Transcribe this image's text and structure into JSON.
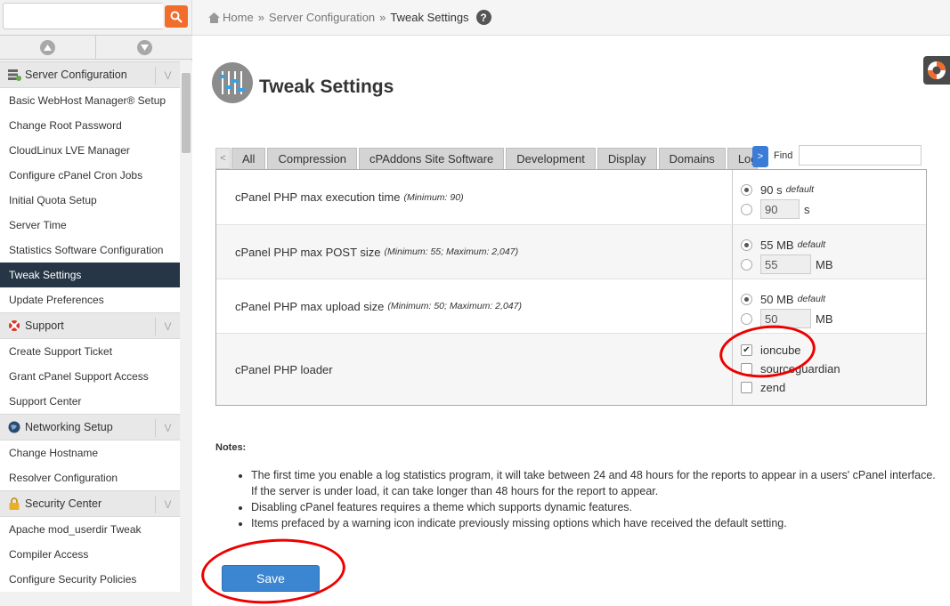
{
  "sidebar": {
    "search": {
      "value": "",
      "placeholder": ""
    },
    "groups": [
      {
        "title": "Server Configuration",
        "items": [
          "Basic WebHost Manager® Setup",
          "Change Root Password",
          "CloudLinux LVE Manager",
          "Configure cPanel Cron Jobs",
          "Initial Quota Setup",
          "Server Time",
          "Statistics Software Configuration",
          "Tweak Settings",
          "Update Preferences"
        ]
      },
      {
        "title": "Support",
        "items": [
          "Create Support Ticket",
          "Grant cPanel Support Access",
          "Support Center"
        ]
      },
      {
        "title": "Networking Setup",
        "items": [
          "Change Hostname",
          "Resolver Configuration"
        ]
      },
      {
        "title": "Security Center",
        "items": [
          "Apache mod_userdir Tweak",
          "Compiler Access",
          "Configure Security Policies"
        ]
      }
    ],
    "active_item": "Tweak Settings",
    "chevron": "V"
  },
  "breadcrumb": {
    "home": "Home",
    "sep": "»",
    "level1": "Server Configuration",
    "current": "Tweak Settings"
  },
  "help_icon": "?",
  "page": {
    "title": "Tweak Settings"
  },
  "tabs": {
    "prev": "<",
    "next": ">",
    "items": [
      "All",
      "Compression",
      "cPAddons Site Software",
      "Development",
      "Display",
      "Domains",
      "Logg"
    ]
  },
  "find": {
    "label": "Find",
    "value": ""
  },
  "settings": [
    {
      "label": "cPanel PHP max execution time",
      "hint": "(Minimum: 90)",
      "default_label": "90 s",
      "default_tag": "default",
      "custom_value": "90",
      "unit": "s"
    },
    {
      "label": "cPanel PHP max POST size",
      "hint": "(Minimum: 55; Maximum: 2,047)",
      "default_label": "55 MB",
      "default_tag": "default",
      "custom_value": "55",
      "unit": "MB"
    },
    {
      "label": "cPanel PHP max upload size",
      "hint": "(Minimum: 50; Maximum: 2,047)",
      "default_label": "50 MB",
      "default_tag": "default",
      "custom_value": "50",
      "unit": "MB"
    }
  ],
  "loader": {
    "label": "cPanel PHP loader",
    "options": [
      {
        "name": "ioncube",
        "checked": true
      },
      {
        "name": "sourceguardian",
        "checked": false
      },
      {
        "name": "zend",
        "checked": false
      }
    ]
  },
  "notes": {
    "title": "Notes:",
    "items": [
      "The first time you enable a log statistics program, it will take between 24 and 48 hours for the reports to appear in a users' cPanel interface. If the server is under load, it can take longer than 48 hours for the report to appear.",
      "Disabling cPanel features requires a theme which supports dynamic features.",
      "Items prefaced by a warning icon indicate previously missing options which have received the default setting."
    ]
  },
  "save_label": "Save",
  "colors": {
    "accent": "#3c86d1",
    "active_nav": "#263646",
    "search_btn": "#f26c2c",
    "annotation": "#e00000"
  }
}
